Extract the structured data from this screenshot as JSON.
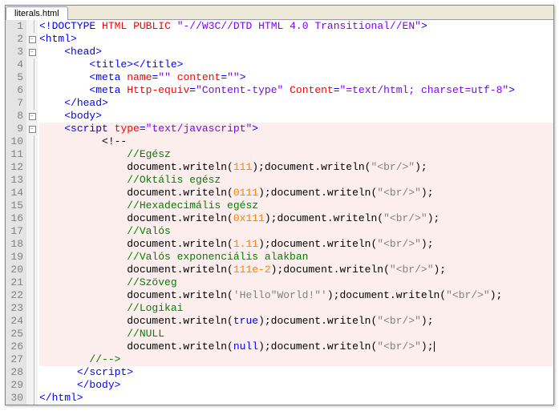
{
  "tab": {
    "label": "literals.html"
  },
  "gutter": [
    "1",
    "2",
    "3",
    "4",
    "5",
    "6",
    "7",
    "8",
    "9",
    "10",
    "11",
    "12",
    "13",
    "14",
    "15",
    "16",
    "17",
    "18",
    "19",
    "20",
    "21",
    "22",
    "23",
    "24",
    "25",
    "26",
    "27",
    "28",
    "29",
    "30"
  ],
  "fold": [
    "",
    "-",
    "-",
    "",
    "",
    "",
    "",
    "-",
    "-",
    "",
    "",
    "",
    "",
    "",
    "",
    "",
    "",
    "",
    "",
    "",
    "",
    "",
    "",
    "",
    "",
    "",
    "",
    "",
    "",
    ""
  ],
  "lines": [
    {
      "i": 1,
      "hl": false,
      "segs": [
        [
          "t-tag",
          "<!DOCTYPE"
        ],
        [
          "t-plain",
          " "
        ],
        [
          "t-attr",
          "HTML"
        ],
        [
          "t-plain",
          " "
        ],
        [
          "t-attr",
          "PUBLIC"
        ],
        [
          "t-plain",
          " "
        ],
        [
          "t-val",
          "\"-//W3C//DTD HTML 4.0 Transitional//EN\""
        ],
        [
          "t-tag",
          ">"
        ]
      ],
      "indent": 0
    },
    {
      "i": 2,
      "hl": false,
      "segs": [
        [
          "t-tag",
          "<html>"
        ]
      ],
      "indent": 0
    },
    {
      "i": 3,
      "hl": false,
      "segs": [
        [
          "t-tag",
          "<head>"
        ]
      ],
      "indent": 2
    },
    {
      "i": 4,
      "hl": false,
      "segs": [
        [
          "t-tag",
          "<title></title>"
        ]
      ],
      "indent": 4
    },
    {
      "i": 5,
      "hl": false,
      "segs": [
        [
          "t-tag",
          "<meta"
        ],
        [
          "t-plain",
          " "
        ],
        [
          "t-attr",
          "name"
        ],
        [
          "t-tag",
          "="
        ],
        [
          "t-val",
          "\"\""
        ],
        [
          "t-plain",
          " "
        ],
        [
          "t-attr",
          "content"
        ],
        [
          "t-tag",
          "="
        ],
        [
          "t-val",
          "\"\""
        ],
        [
          "t-tag",
          ">"
        ]
      ],
      "indent": 4
    },
    {
      "i": 6,
      "hl": false,
      "segs": [
        [
          "t-tag",
          "<meta"
        ],
        [
          "t-plain",
          " "
        ],
        [
          "t-attr",
          "Http-equiv"
        ],
        [
          "t-tag",
          "="
        ],
        [
          "t-val",
          "\"Content-type\""
        ],
        [
          "t-plain",
          " "
        ],
        [
          "t-attr",
          "Content"
        ],
        [
          "t-tag",
          "="
        ],
        [
          "t-val",
          "\"=text/html; charset=utf-8\""
        ],
        [
          "t-tag",
          ">"
        ]
      ],
      "indent": 4
    },
    {
      "i": 7,
      "hl": false,
      "segs": [
        [
          "t-tag",
          "</head>"
        ]
      ],
      "indent": 2
    },
    {
      "i": 8,
      "hl": false,
      "segs": [
        [
          "t-tag",
          "<body>"
        ]
      ],
      "indent": 2
    },
    {
      "i": 9,
      "hl": true,
      "segs": [
        [
          "t-tag",
          "<script"
        ],
        [
          "t-plain",
          " "
        ],
        [
          "t-attr",
          "type"
        ],
        [
          "t-tag",
          "="
        ],
        [
          "t-val",
          "\"text/javascript\""
        ],
        [
          "t-tag",
          ">"
        ]
      ],
      "indent": 2
    },
    {
      "i": 10,
      "hl": true,
      "segs": [
        [
          "t-plain",
          "<!--"
        ]
      ],
      "indent": 5
    },
    {
      "i": 11,
      "hl": true,
      "segs": [
        [
          "t-com",
          "//Egész"
        ]
      ],
      "indent": 7
    },
    {
      "i": 12,
      "hl": true,
      "segs": [
        [
          "t-plain",
          "document.writeln("
        ],
        [
          "t-num",
          "111"
        ],
        [
          "t-plain",
          ");document.writeln("
        ],
        [
          "t-str",
          "\"<br/>\""
        ],
        [
          "t-plain",
          ");"
        ]
      ],
      "indent": 7
    },
    {
      "i": 13,
      "hl": true,
      "segs": [
        [
          "t-com",
          "//Oktális egész"
        ]
      ],
      "indent": 7
    },
    {
      "i": 14,
      "hl": true,
      "segs": [
        [
          "t-plain",
          "document.writeln("
        ],
        [
          "t-num",
          "0111"
        ],
        [
          "t-plain",
          ");document.writeln("
        ],
        [
          "t-str",
          "\"<br/>\""
        ],
        [
          "t-plain",
          ");"
        ]
      ],
      "indent": 7
    },
    {
      "i": 15,
      "hl": true,
      "segs": [
        [
          "t-com",
          "//Hexadecimális egész"
        ]
      ],
      "indent": 7
    },
    {
      "i": 16,
      "hl": true,
      "segs": [
        [
          "t-plain",
          "document.writeln("
        ],
        [
          "t-num",
          "0x111"
        ],
        [
          "t-plain",
          ");document.writeln("
        ],
        [
          "t-str",
          "\"<br/>\""
        ],
        [
          "t-plain",
          ");"
        ]
      ],
      "indent": 7
    },
    {
      "i": 17,
      "hl": true,
      "segs": [
        [
          "t-com",
          "//Valós"
        ]
      ],
      "indent": 7
    },
    {
      "i": 18,
      "hl": true,
      "segs": [
        [
          "t-plain",
          "document.writeln("
        ],
        [
          "t-num",
          "1.11"
        ],
        [
          "t-plain",
          ");document.writeln("
        ],
        [
          "t-str",
          "\"<br/>\""
        ],
        [
          "t-plain",
          ");"
        ]
      ],
      "indent": 7
    },
    {
      "i": 19,
      "hl": true,
      "segs": [
        [
          "t-com",
          "//Valós exponenciális alakban"
        ]
      ],
      "indent": 7
    },
    {
      "i": 20,
      "hl": true,
      "segs": [
        [
          "t-plain",
          "document.writeln("
        ],
        [
          "t-num",
          "111e-2"
        ],
        [
          "t-plain",
          ");document.writeln("
        ],
        [
          "t-str",
          "\"<br/>\""
        ],
        [
          "t-plain",
          ");"
        ]
      ],
      "indent": 7
    },
    {
      "i": 21,
      "hl": true,
      "segs": [
        [
          "t-com",
          "//Szöveg"
        ]
      ],
      "indent": 7
    },
    {
      "i": 22,
      "hl": true,
      "segs": [
        [
          "t-plain",
          "document.writeln("
        ],
        [
          "t-str",
          "'Hello\"World!\"'"
        ],
        [
          "t-plain",
          ");document.writeln("
        ],
        [
          "t-str",
          "\"<br/>\""
        ],
        [
          "t-plain",
          ");"
        ]
      ],
      "indent": 7
    },
    {
      "i": 23,
      "hl": true,
      "segs": [
        [
          "t-com",
          "//Logikai"
        ]
      ],
      "indent": 7
    },
    {
      "i": 24,
      "hl": true,
      "segs": [
        [
          "t-plain",
          "document.writeln("
        ],
        [
          "t-kw",
          "true"
        ],
        [
          "t-plain",
          ");document.writeln("
        ],
        [
          "t-str",
          "\"<br/>\""
        ],
        [
          "t-plain",
          ");"
        ]
      ],
      "indent": 7
    },
    {
      "i": 25,
      "hl": true,
      "segs": [
        [
          "t-com",
          "//NULL"
        ]
      ],
      "indent": 7
    },
    {
      "i": 26,
      "hl": true,
      "segs": [
        [
          "t-plain",
          "document.writeln("
        ],
        [
          "t-null",
          "null"
        ],
        [
          "t-plain",
          ");document.writeln("
        ],
        [
          "t-str",
          "\"<br/>\""
        ],
        [
          "t-plain",
          ");"
        ],
        [
          "cursor",
          ""
        ]
      ],
      "indent": 7
    },
    {
      "i": 27,
      "hl": true,
      "segs": [
        [
          "t-com",
          "//-->"
        ]
      ],
      "indent": 4
    },
    {
      "i": 28,
      "hl": false,
      "segs": [
        [
          "t-tag",
          "</script"
        ],
        [
          "t-tag",
          ">"
        ]
      ],
      "indent": 3
    },
    {
      "i": 29,
      "hl": false,
      "segs": [
        [
          "t-tag",
          "</body>"
        ]
      ],
      "indent": 3
    },
    {
      "i": 30,
      "hl": false,
      "segs": [
        [
          "t-tag",
          "</html>"
        ]
      ],
      "indent": 0
    }
  ]
}
